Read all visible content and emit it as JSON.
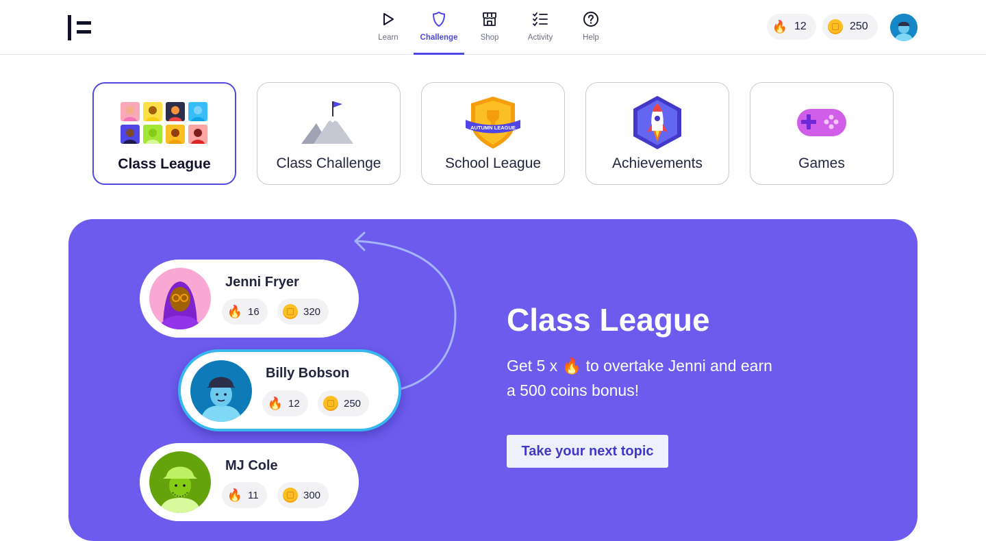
{
  "header": {
    "nav": [
      {
        "label": "Learn",
        "icon": "play-icon",
        "active": false
      },
      {
        "label": "Challenge",
        "icon": "shield-icon",
        "active": true
      },
      {
        "label": "Shop",
        "icon": "shop-icon",
        "active": false
      },
      {
        "label": "Activity",
        "icon": "checklist-icon",
        "active": false
      },
      {
        "label": "Help",
        "icon": "help-icon",
        "active": false
      }
    ],
    "streak": "12",
    "coins": "250"
  },
  "tiles": [
    {
      "label": "Class League",
      "icon": "avatars-grid-icon",
      "active": true
    },
    {
      "label": "Class Challenge",
      "icon": "mountain-flag-icon",
      "active": false
    },
    {
      "label": "School League",
      "icon": "league-badge-icon",
      "badge_text": "AUTUMN LEAGUE",
      "active": false
    },
    {
      "label": "Achievements",
      "icon": "rocket-icon",
      "active": false
    },
    {
      "label": "Games",
      "icon": "gamepad-icon",
      "active": false
    }
  ],
  "banner": {
    "title": "Class League",
    "text_before": "Get 5 x ",
    "text_after": " to overtake Jenni and earn a 500 coins bonus!",
    "button": "Take your next topic",
    "players": [
      {
        "name": "Jenni Fryer",
        "streak": "16",
        "coins": "320"
      },
      {
        "name": "Billy Bobson",
        "streak": "12",
        "coins": "250"
      },
      {
        "name": "MJ Cole",
        "streak": "11",
        "coins": "300"
      }
    ]
  },
  "colors": {
    "accent": "#4f46e5",
    "banner": "#6c5bed",
    "highlight": "#38b6f0",
    "coin": "#fbbf24"
  }
}
